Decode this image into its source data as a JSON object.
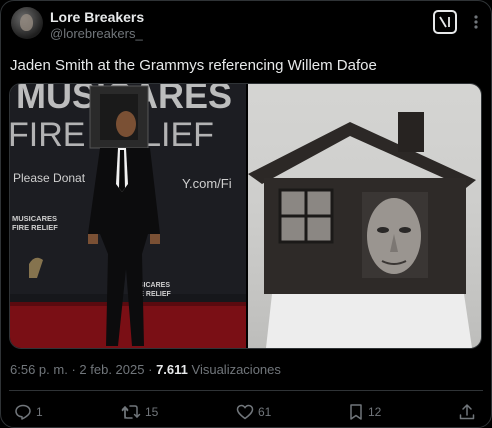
{
  "author": {
    "display_name": "Lore Breakers",
    "handle": "@lorebreakers_"
  },
  "tweet": {
    "text": "Jaden Smith at the Grammys referencing Willem Dafoe"
  },
  "media": {
    "left_banner_text": [
      "MUSICARES",
      "FIRE RELIEF"
    ],
    "left_banner_lower": "Please Donat",
    "left_banner_url": "Y.com/Fi",
    "left_logo": [
      "MUSICARES",
      "FIRE RELIEF"
    ],
    "center_logo": [
      "MUSICARES",
      "FIRE RELIEF"
    ]
  },
  "meta": {
    "time": "6:56 p. m.",
    "separator": "·",
    "date": "2 feb. 2025",
    "views_count": "7.611",
    "views_label": "Visualizaciones"
  },
  "actions": {
    "reply_count": "1",
    "retweet_count": "15",
    "like_count": "61",
    "bookmark_count": "12"
  },
  "icons": {
    "grok": "grok-icon",
    "more": "more-icon",
    "reply": "reply-icon",
    "retweet": "retweet-icon",
    "like": "heart-icon",
    "bookmark": "bookmark-icon",
    "share": "share-icon"
  },
  "colors": {
    "background": "#000000",
    "text": "#e7e9ea",
    "muted": "#71767b",
    "border": "#2f3336"
  }
}
